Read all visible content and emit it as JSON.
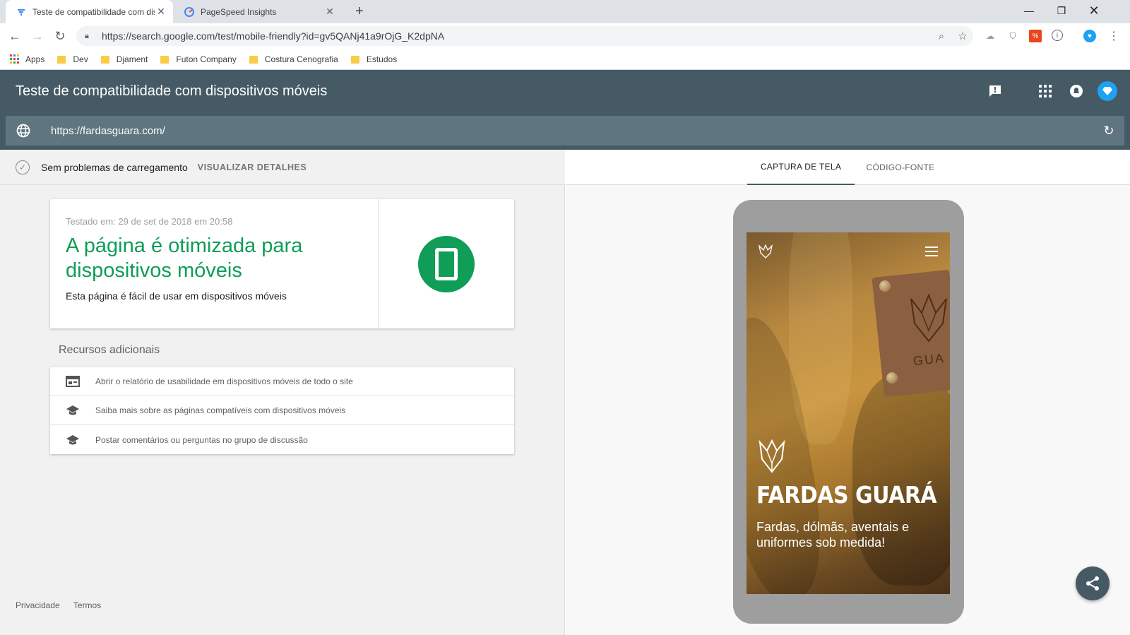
{
  "browser": {
    "tabs": [
      {
        "title": "Teste de compatibilidade com dispositivos móveis",
        "active": true
      },
      {
        "title": "PageSpeed Insights",
        "active": false
      }
    ],
    "address": "https://search.google.com/test/mobile-friendly?id=gv5QANj41a9rOjG_K2dpNA",
    "bookmarks": [
      "Apps",
      "Dev",
      "Djament",
      "Futon Company",
      "Costura Cenografia",
      "Estudos"
    ]
  },
  "header": {
    "title": "Teste de compatibilidade com dispositivos móveis",
    "url_value": "https://fardasguara.com/"
  },
  "status": {
    "text": "Sem problemas de carregamento",
    "details_link": "VISUALIZAR DETALHES"
  },
  "result": {
    "tested_at": "Testado em: 29 de set de 2018 em 20:58",
    "headline": "A página é otimizada para dispositivos móveis",
    "subtitle": "Esta página é fácil de usar em dispositivos móveis"
  },
  "resources": {
    "title": "Recursos adicionais",
    "items": [
      {
        "label": "Abrir o relatório de usabilidade em dispositivos móveis de todo o site",
        "icon": "report-icon"
      },
      {
        "label": "Saiba mais sobre as páginas compatíveis com dispositivos móveis",
        "icon": "school-icon"
      },
      {
        "label": "Postar comentários ou perguntas no grupo de discussão",
        "icon": "school-icon"
      }
    ]
  },
  "footer": {
    "privacy": "Privacidade",
    "terms": "Termos"
  },
  "preview": {
    "tabs": [
      "CAPTURA DE TELA",
      "CÓDIGO-FONTE"
    ],
    "active_tab": "CAPTURA DE TELA",
    "brand": "FARDAS GUARÁ",
    "tagline": "Fardas, dólmãs, aventais e uniformes sob medida!",
    "patch_text": "GUA"
  },
  "colors": {
    "header_bg": "#455a64",
    "success_green": "#0f9d58"
  }
}
